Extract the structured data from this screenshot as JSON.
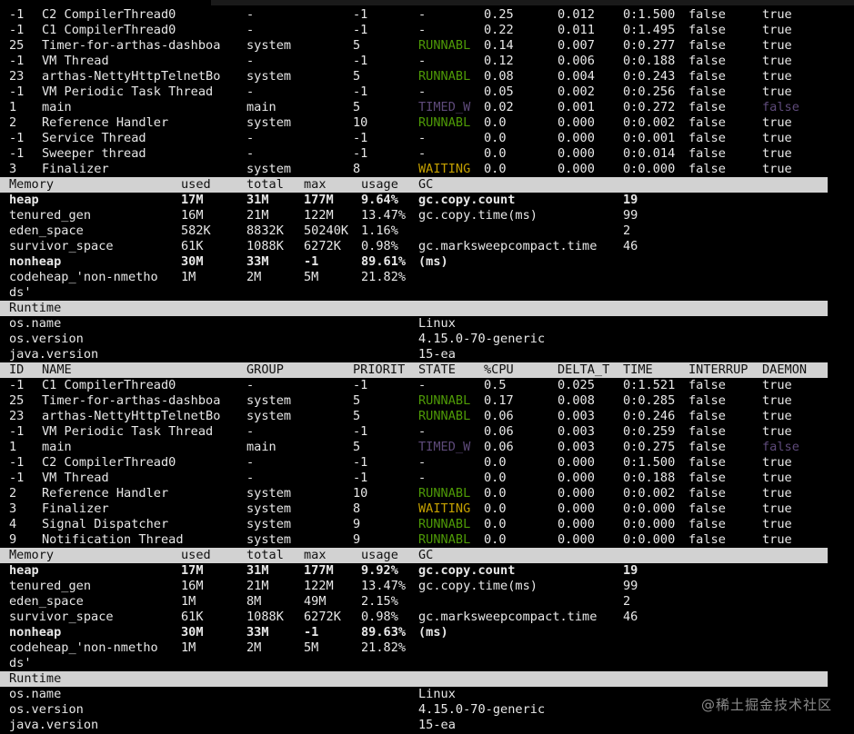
{
  "thread_header": {
    "id": "ID",
    "name": "NAME",
    "group": "GROUP",
    "priority": "PRIORIT",
    "state": "STATE",
    "cpu": "%CPU",
    "delta": "DELTA_T",
    "time": "TIME",
    "interrupted": "INTERRUP",
    "daemon": "DAEMON"
  },
  "memory_header": {
    "memory": "Memory",
    "used": "used",
    "total": "total",
    "max": "max",
    "usage": "usage",
    "gc": "GC"
  },
  "runtime_header": "Runtime",
  "sections": [
    {
      "threads": [
        {
          "id": "-1",
          "name": "C2 CompilerThread0",
          "group": "-",
          "priority": "-1",
          "state": "-",
          "cpu": "0.25",
          "delta": "0.012",
          "time": "0:1.500",
          "interrupted": "false",
          "daemon": "true",
          "state_color": "#e8e8e8",
          "daemon_color": "#e8e8e8"
        },
        {
          "id": "-1",
          "name": "C1 CompilerThread0",
          "group": "-",
          "priority": "-1",
          "state": "-",
          "cpu": "0.22",
          "delta": "0.011",
          "time": "0:1.495",
          "interrupted": "false",
          "daemon": "true",
          "state_color": "#e8e8e8",
          "daemon_color": "#e8e8e8"
        },
        {
          "id": "25",
          "name": "Timer-for-arthas-dashboa",
          "group": "system",
          "priority": "5",
          "state": "RUNNABL",
          "cpu": "0.14",
          "delta": "0.007",
          "time": "0:0.277",
          "interrupted": "false",
          "daemon": "true",
          "state_color": "#4e9a06",
          "daemon_color": "#e8e8e8"
        },
        {
          "id": "-1",
          "name": "VM Thread",
          "group": "-",
          "priority": "-1",
          "state": "-",
          "cpu": "0.12",
          "delta": "0.006",
          "time": "0:0.188",
          "interrupted": "false",
          "daemon": "true",
          "state_color": "#e8e8e8",
          "daemon_color": "#e8e8e8"
        },
        {
          "id": "23",
          "name": "arthas-NettyHttpTelnetBo",
          "group": "system",
          "priority": "5",
          "state": "RUNNABL",
          "cpu": "0.08",
          "delta": "0.004",
          "time": "0:0.243",
          "interrupted": "false",
          "daemon": "true",
          "state_color": "#4e9a06",
          "daemon_color": "#e8e8e8"
        },
        {
          "id": "-1",
          "name": "VM Periodic Task Thread",
          "group": "-",
          "priority": "-1",
          "state": "-",
          "cpu": "0.05",
          "delta": "0.002",
          "time": "0:0.256",
          "interrupted": "false",
          "daemon": "true",
          "state_color": "#e8e8e8",
          "daemon_color": "#e8e8e8"
        },
        {
          "id": "1",
          "name": "main",
          "group": "main",
          "priority": "5",
          "state": "TIMED_W",
          "cpu": "0.02",
          "delta": "0.001",
          "time": "0:0.272",
          "interrupted": "false",
          "daemon": "false",
          "state_color": "#5e4a7a",
          "daemon_color": "#5e4a7a"
        },
        {
          "id": "2",
          "name": "Reference Handler",
          "group": "system",
          "priority": "10",
          "state": "RUNNABL",
          "cpu": "0.0",
          "delta": "0.000",
          "time": "0:0.002",
          "interrupted": "false",
          "daemon": "true",
          "state_color": "#4e9a06",
          "daemon_color": "#e8e8e8"
        },
        {
          "id": "-1",
          "name": "Service Thread",
          "group": "-",
          "priority": "-1",
          "state": "-",
          "cpu": "0.0",
          "delta": "0.000",
          "time": "0:0.001",
          "interrupted": "false",
          "daemon": "true",
          "state_color": "#e8e8e8",
          "daemon_color": "#e8e8e8"
        },
        {
          "id": "-1",
          "name": "Sweeper thread",
          "group": "-",
          "priority": "-1",
          "state": "-",
          "cpu": "0.0",
          "delta": "0.000",
          "time": "0:0.014",
          "interrupted": "false",
          "daemon": "true",
          "state_color": "#e8e8e8",
          "daemon_color": "#e8e8e8"
        },
        {
          "id": "3",
          "name": "Finalizer",
          "group": "system",
          "priority": "8",
          "state": "WAITING",
          "cpu": "0.0",
          "delta": "0.000",
          "time": "0:0.000",
          "interrupted": "false",
          "daemon": "true",
          "state_color": "#c4a000",
          "daemon_color": "#e8e8e8"
        }
      ],
      "memory": [
        {
          "name": "heap",
          "used": "17M",
          "total": "31M",
          "max": "177M",
          "usage": "9.64%",
          "gc": "gc.copy.count",
          "gcval": "19",
          "bold": true
        },
        {
          "name": "tenured_gen",
          "used": "16M",
          "total": "21M",
          "max": "122M",
          "usage": "13.47%",
          "gc": "gc.copy.time(ms)",
          "gcval": "99",
          "bold": false
        },
        {
          "name": "eden_space",
          "used": "582K",
          "total": "8832K",
          "max": "50240K",
          "usage": "1.16%",
          "gc": "",
          "gcval": "2",
          "bold": false
        },
        {
          "name": "survivor_space",
          "used": "61K",
          "total": "1088K",
          "max": "6272K",
          "usage": "0.98%",
          "gc": "gc.marksweepcompact.time",
          "gcval": "46",
          "bold": false
        },
        {
          "name": "nonheap",
          "used": "30M",
          "total": "33M",
          "max": "-1",
          "usage": "89.61%",
          "gc": "(ms)",
          "gcval": "",
          "bold": true
        },
        {
          "name": "codeheap_'non-nmetho",
          "used": "1M",
          "total": "2M",
          "max": "5M",
          "usage": "21.82%",
          "gc": "",
          "gcval": "",
          "bold": false
        },
        {
          "name": "ds'",
          "used": "",
          "total": "",
          "max": "",
          "usage": "",
          "gc": "",
          "gcval": "",
          "bold": false
        }
      ],
      "runtime": [
        {
          "key": "os.name",
          "value": "Linux"
        },
        {
          "key": "os.version",
          "value": "4.15.0-70-generic"
        },
        {
          "key": "java.version",
          "value": "15-ea"
        }
      ]
    },
    {
      "threads": [
        {
          "id": "-1",
          "name": "C1 CompilerThread0",
          "group": "-",
          "priority": "-1",
          "state": "-",
          "cpu": "0.5",
          "delta": "0.025",
          "time": "0:1.521",
          "interrupted": "false",
          "daemon": "true",
          "state_color": "#e8e8e8",
          "daemon_color": "#e8e8e8"
        },
        {
          "id": "25",
          "name": "Timer-for-arthas-dashboa",
          "group": "system",
          "priority": "5",
          "state": "RUNNABL",
          "cpu": "0.17",
          "delta": "0.008",
          "time": "0:0.285",
          "interrupted": "false",
          "daemon": "true",
          "state_color": "#4e9a06",
          "daemon_color": "#e8e8e8"
        },
        {
          "id": "23",
          "name": "arthas-NettyHttpTelnetBo",
          "group": "system",
          "priority": "5",
          "state": "RUNNABL",
          "cpu": "0.06",
          "delta": "0.003",
          "time": "0:0.246",
          "interrupted": "false",
          "daemon": "true",
          "state_color": "#4e9a06",
          "daemon_color": "#e8e8e8"
        },
        {
          "id": "-1",
          "name": "VM Periodic Task Thread",
          "group": "-",
          "priority": "-1",
          "state": "-",
          "cpu": "0.06",
          "delta": "0.003",
          "time": "0:0.259",
          "interrupted": "false",
          "daemon": "true",
          "state_color": "#e8e8e8",
          "daemon_color": "#e8e8e8"
        },
        {
          "id": "1",
          "name": "main",
          "group": "main",
          "priority": "5",
          "state": "TIMED_W",
          "cpu": "0.06",
          "delta": "0.003",
          "time": "0:0.275",
          "interrupted": "false",
          "daemon": "false",
          "state_color": "#5e4a7a",
          "daemon_color": "#5e4a7a"
        },
        {
          "id": "-1",
          "name": "C2 CompilerThread0",
          "group": "-",
          "priority": "-1",
          "state": "-",
          "cpu": "0.0",
          "delta": "0.000",
          "time": "0:1.500",
          "interrupted": "false",
          "daemon": "true",
          "state_color": "#e8e8e8",
          "daemon_color": "#e8e8e8"
        },
        {
          "id": "-1",
          "name": "VM Thread",
          "group": "-",
          "priority": "-1",
          "state": "-",
          "cpu": "0.0",
          "delta": "0.000",
          "time": "0:0.188",
          "interrupted": "false",
          "daemon": "true",
          "state_color": "#e8e8e8",
          "daemon_color": "#e8e8e8"
        },
        {
          "id": "2",
          "name": "Reference Handler",
          "group": "system",
          "priority": "10",
          "state": "RUNNABL",
          "cpu": "0.0",
          "delta": "0.000",
          "time": "0:0.002",
          "interrupted": "false",
          "daemon": "true",
          "state_color": "#4e9a06",
          "daemon_color": "#e8e8e8"
        },
        {
          "id": "3",
          "name": "Finalizer",
          "group": "system",
          "priority": "8",
          "state": "WAITING",
          "cpu": "0.0",
          "delta": "0.000",
          "time": "0:0.000",
          "interrupted": "false",
          "daemon": "true",
          "state_color": "#c4a000",
          "daemon_color": "#e8e8e8"
        },
        {
          "id": "4",
          "name": "Signal Dispatcher",
          "group": "system",
          "priority": "9",
          "state": "RUNNABL",
          "cpu": "0.0",
          "delta": "0.000",
          "time": "0:0.000",
          "interrupted": "false",
          "daemon": "true",
          "state_color": "#4e9a06",
          "daemon_color": "#e8e8e8"
        },
        {
          "id": "9",
          "name": "Notification Thread",
          "group": "system",
          "priority": "9",
          "state": "RUNNABL",
          "cpu": "0.0",
          "delta": "0.000",
          "time": "0:0.000",
          "interrupted": "false",
          "daemon": "true",
          "state_color": "#4e9a06",
          "daemon_color": "#e8e8e8"
        }
      ],
      "memory": [
        {
          "name": "heap",
          "used": "17M",
          "total": "31M",
          "max": "177M",
          "usage": "9.92%",
          "gc": "gc.copy.count",
          "gcval": "19",
          "bold": true
        },
        {
          "name": "tenured_gen",
          "used": "16M",
          "total": "21M",
          "max": "122M",
          "usage": "13.47%",
          "gc": "gc.copy.time(ms)",
          "gcval": "99",
          "bold": false
        },
        {
          "name": "eden_space",
          "used": "1M",
          "total": "8M",
          "max": "49M",
          "usage": "2.15%",
          "gc": "",
          "gcval": "2",
          "bold": false
        },
        {
          "name": "survivor_space",
          "used": "61K",
          "total": "1088K",
          "max": "6272K",
          "usage": "0.98%",
          "gc": "gc.marksweepcompact.time",
          "gcval": "46",
          "bold": false
        },
        {
          "name": "nonheap",
          "used": "30M",
          "total": "33M",
          "max": "-1",
          "usage": "89.63%",
          "gc": "(ms)",
          "gcval": "",
          "bold": true
        },
        {
          "name": "codeheap_'non-nmetho",
          "used": "1M",
          "total": "2M",
          "max": "5M",
          "usage": "21.82%",
          "gc": "",
          "gcval": "",
          "bold": false
        },
        {
          "name": "ds'",
          "used": "",
          "total": "",
          "max": "",
          "usage": "",
          "gc": "",
          "gcval": "",
          "bold": false
        }
      ],
      "runtime": [
        {
          "key": "os.name",
          "value": "Linux"
        },
        {
          "key": "os.version",
          "value": "4.15.0-70-generic"
        },
        {
          "key": "java.version",
          "value": "15-ea"
        }
      ]
    }
  ],
  "watermark": "@稀土掘金技术社区"
}
